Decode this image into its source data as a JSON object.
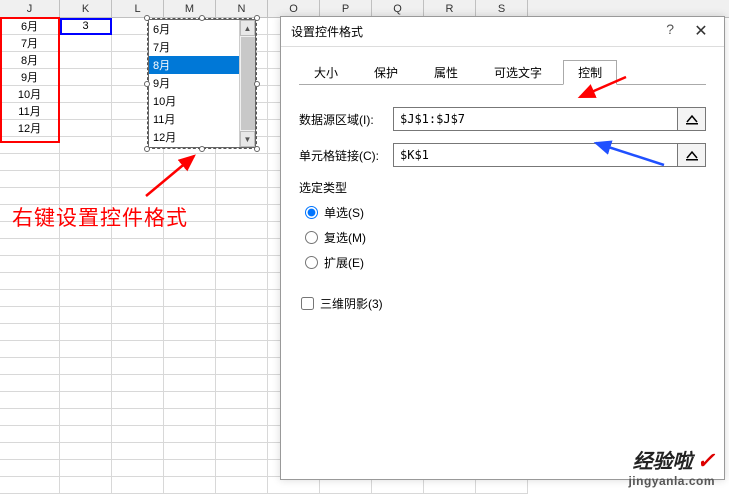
{
  "columns": [
    "J",
    "K",
    "L",
    "M",
    "N",
    "O",
    "P",
    "Q",
    "R",
    "S"
  ],
  "col_j": [
    "6月",
    "7月",
    "8月",
    "9月",
    "10月",
    "11月",
    "12月"
  ],
  "k1_value": "3",
  "listbox_items": [
    "6月",
    "7月",
    "8月",
    "9月",
    "10月",
    "11月",
    "12月"
  ],
  "listbox_selected_index": 2,
  "annotation_text": "右键设置控件格式",
  "dialog": {
    "title": "设置控件格式",
    "help": "?",
    "close": "✕",
    "tabs": [
      "大小",
      "保护",
      "属性",
      "可选文字",
      "控制"
    ],
    "active_tab_index": 4,
    "source_label": "数据源区域(I):",
    "source_value": "$J$1:$J$7",
    "link_label": "单元格链接(C):",
    "link_value": "$K$1",
    "selection_type_label": "选定类型",
    "radios": [
      {
        "label": "单选(S)",
        "checked": true
      },
      {
        "label": "复选(M)",
        "checked": false
      },
      {
        "label": "扩展(E)",
        "checked": false
      }
    ],
    "shadow_label": "三维阴影(3)"
  },
  "watermark": {
    "top": "经验啦",
    "check": "✓",
    "bottom": "jingyanla.com"
  }
}
